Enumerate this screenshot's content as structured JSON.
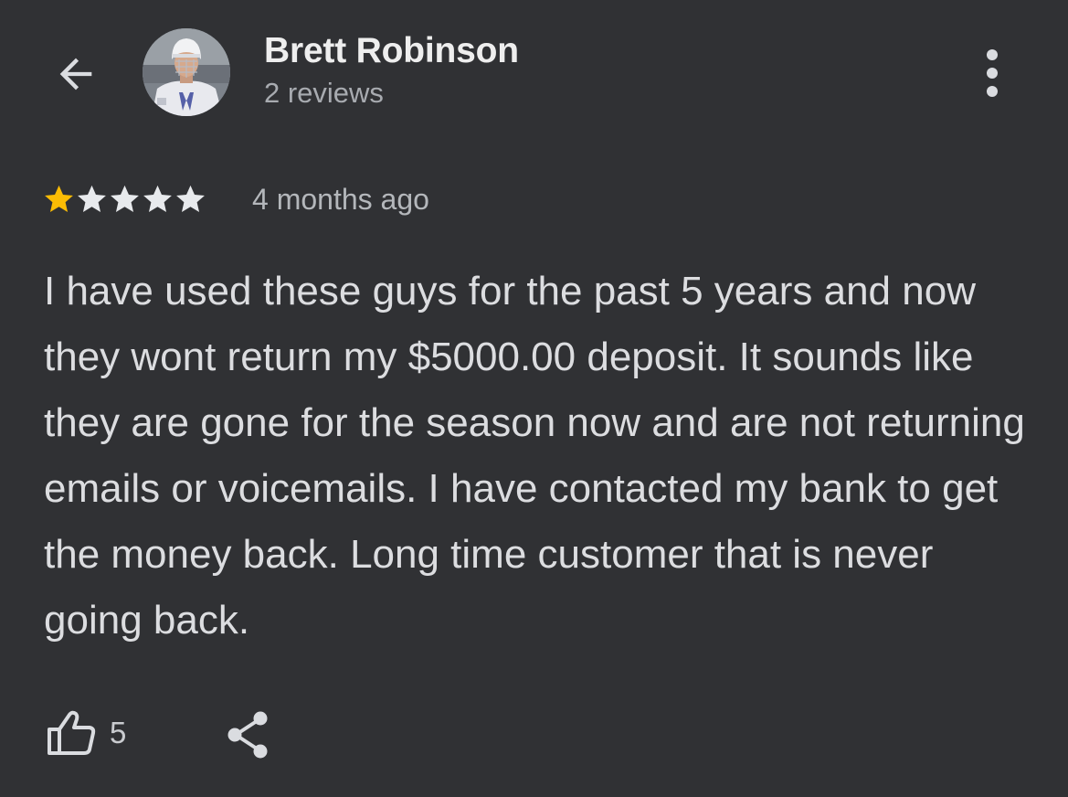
{
  "header": {
    "back_icon": "arrow-back-icon",
    "author_name": "Brett Robinson",
    "author_reviews": "2 reviews",
    "more_icon": "more-vert-icon"
  },
  "review": {
    "rating": 1,
    "max_rating": 5,
    "filled_star_color": "#fbbc04",
    "empty_star_color": "#e8eaed",
    "time": "4 months ago",
    "text": "I have used these guys for the past 5 years and now they wont return my $5000.00 deposit. It sounds like they are gone for the season now and are not returning emails or voicemails. I have contacted my bank to get the money back. Long time customer that is never going back."
  },
  "actions": {
    "like_icon": "thumb-up-icon",
    "like_count": "5",
    "share_icon": "share-icon"
  }
}
